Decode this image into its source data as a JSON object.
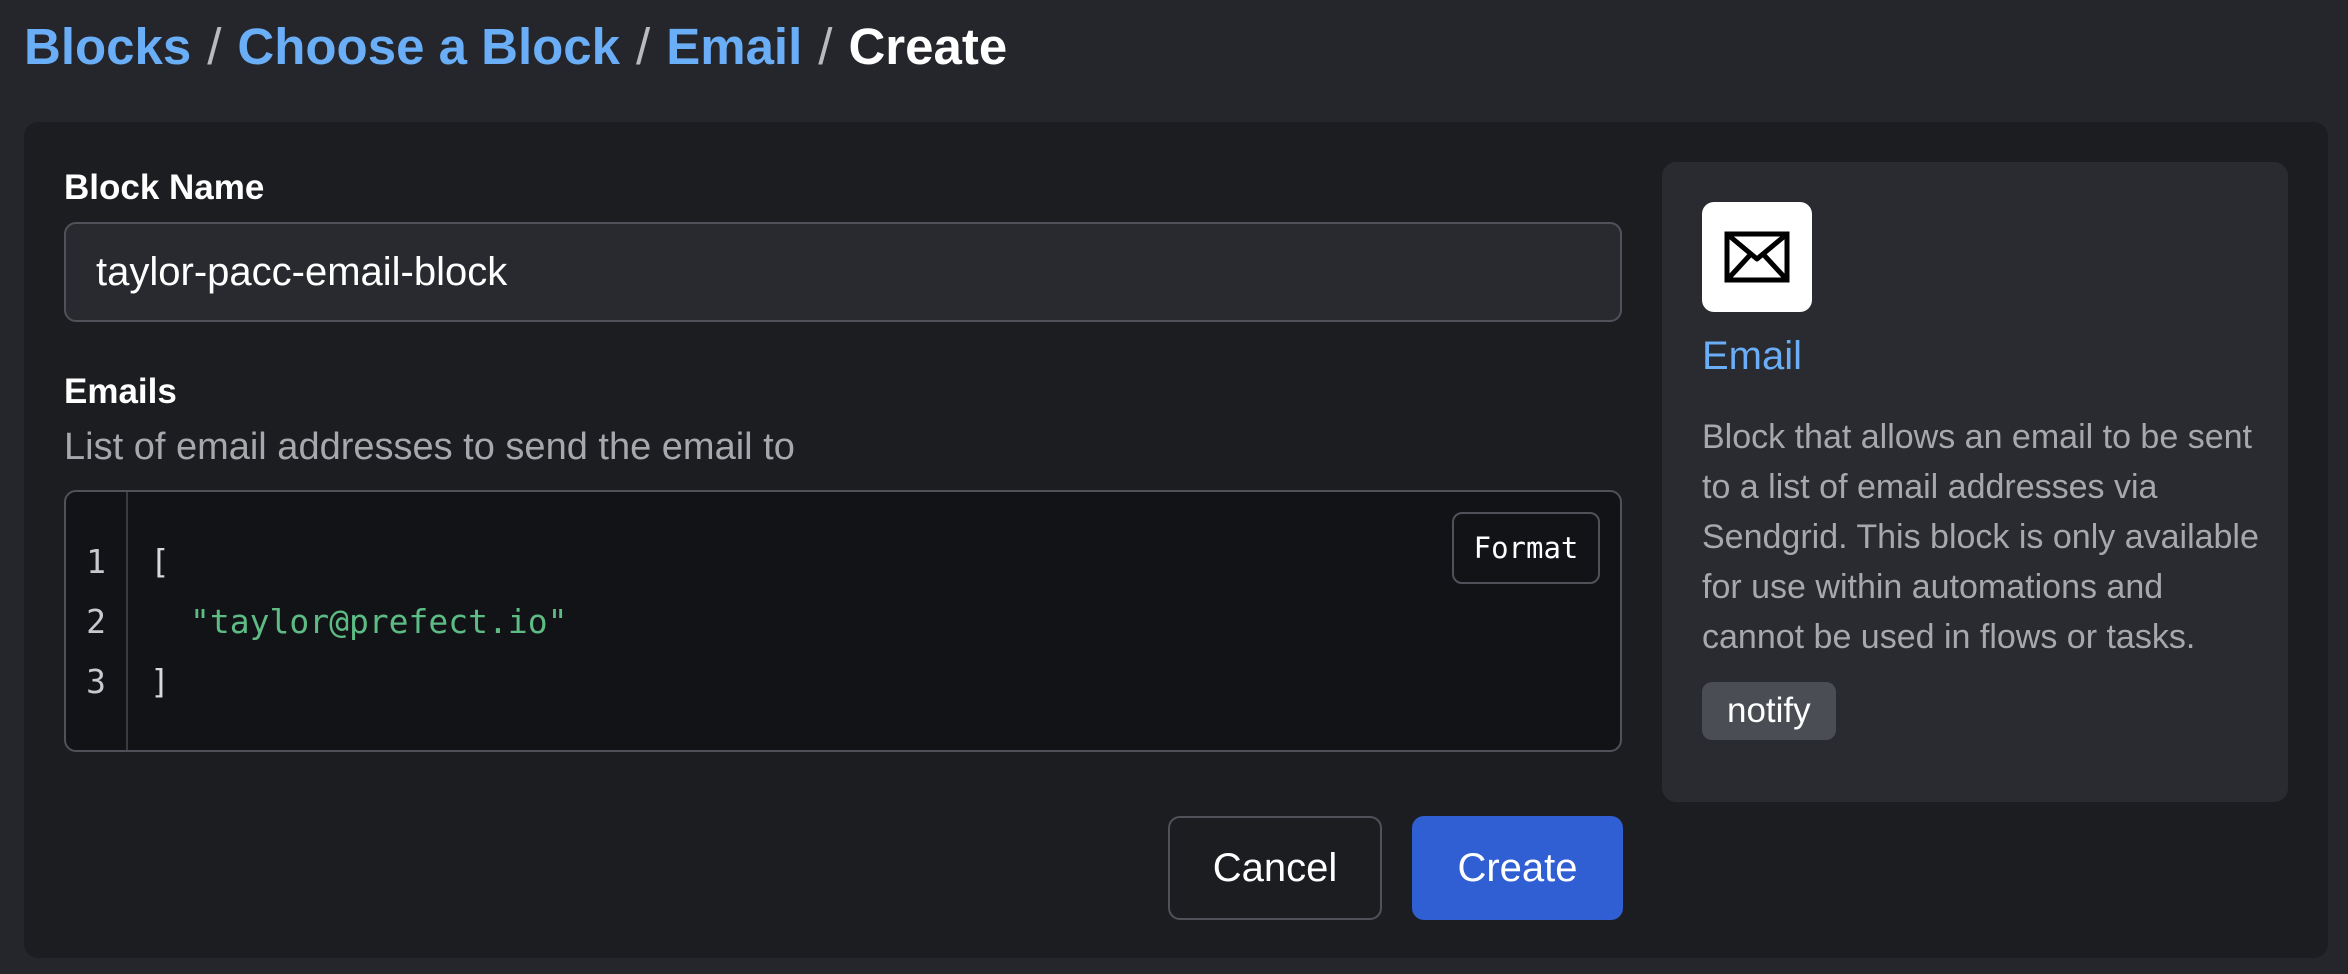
{
  "breadcrumb": {
    "items": [
      "Blocks",
      "Choose a Block",
      "Email"
    ],
    "separator": "/",
    "current": "Create"
  },
  "form": {
    "block_name_label": "Block Name",
    "block_name_value": "taylor-pacc-email-block",
    "emails_label": "Emails",
    "emails_description": "List of email addresses to send the email to",
    "editor": {
      "line_numbers": [
        "1",
        "2",
        "3"
      ],
      "lines": [
        "[",
        "\"taylor@prefect.io\"",
        "]"
      ],
      "format_label": "Format"
    },
    "cancel_label": "Cancel",
    "create_label": "Create"
  },
  "block_info": {
    "icon": "envelope-icon",
    "title": "Email",
    "description": "Block that allows an email to be sent to a list of email addresses via Sendgrid. This block is only available for use within automations and cannot be used in flows or tasks.",
    "tag": "notify"
  },
  "colors": {
    "background": "#25262b",
    "card": "#1c1d21",
    "link": "#6aaef7",
    "primary_button": "#2f5fd3",
    "code_string": "#5dbb84"
  }
}
